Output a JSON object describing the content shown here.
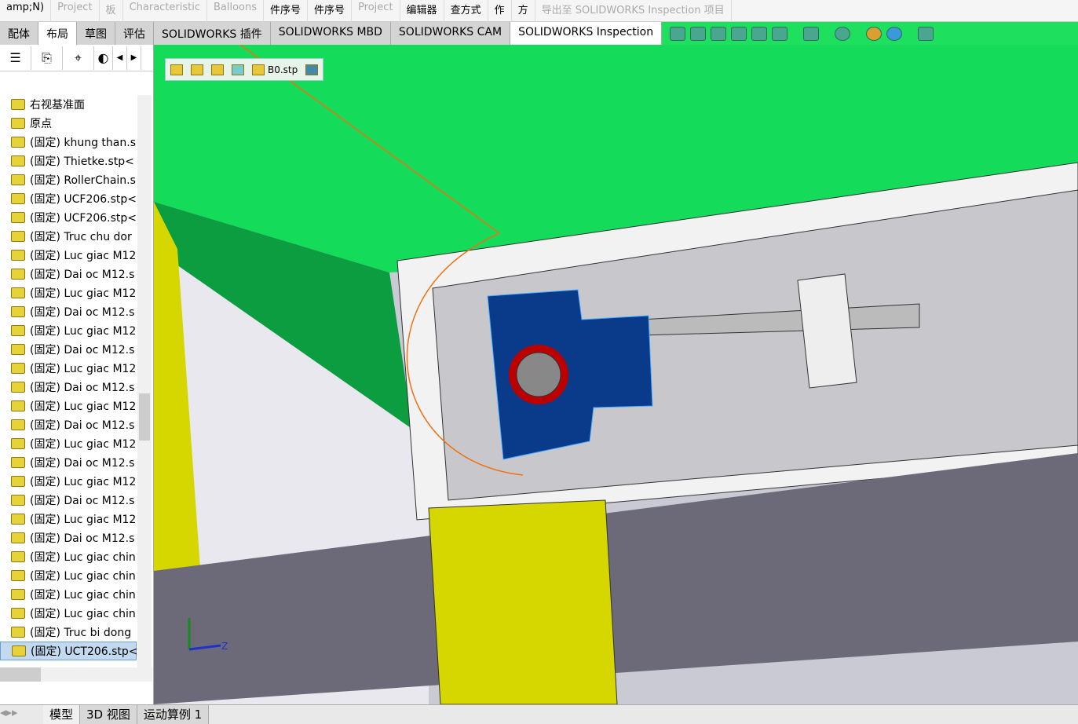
{
  "ribbon": [
    "amp;N)",
    "Project",
    "板",
    "Characteristic",
    "Balloons",
    "件序号",
    "件序号",
    "Project",
    "编辑器",
    "查方式",
    "作",
    "方",
    "导出至 SOLIDWORKS Inspection 项目"
  ],
  "tabs": [
    {
      "label": "配体"
    },
    {
      "label": "布局",
      "active": true
    },
    {
      "label": "草图"
    },
    {
      "label": "评估"
    },
    {
      "label": "SOLIDWORKS 插件"
    },
    {
      "label": "SOLIDWORKS MBD"
    },
    {
      "label": "SOLIDWORKS CAM"
    },
    {
      "label": "SOLIDWORKS Inspection",
      "active": true
    }
  ],
  "breadcrumb": {
    "file": "B0.stp"
  },
  "tree": {
    "items": [
      "右视基准面",
      "原点",
      "(固定) khung than.s",
      "(固定) Thietke.stp<",
      "(固定) RollerChain.s",
      "(固定) UCF206.stp<",
      "(固定) UCF206.stp<",
      "(固定) Truc chu dor",
      "(固定) Luc giac M12",
      "(固定) Dai oc M12.s",
      "(固定) Luc giac M12",
      "(固定) Dai oc M12.s",
      "(固定) Luc giac M12",
      "(固定) Dai oc M12.s",
      "(固定) Luc giac M12",
      "(固定) Dai oc M12.s",
      "(固定) Luc giac M12",
      "(固定) Dai oc M12.s",
      "(固定) Luc giac M12",
      "(固定) Dai oc M12.s",
      "(固定) Luc giac M12",
      "(固定) Dai oc M12.s",
      "(固定) Luc giac M12",
      "(固定) Dai oc M12.s",
      "(固定) Luc giac chin",
      "(固定) Luc giac chin",
      "(固定) Luc giac chin",
      "(固定) Luc giac chin",
      "(固定) Truc bi dong",
      "(固定) UCT206.stp<"
    ],
    "selected": 29
  },
  "triad": {
    "z": "Z"
  },
  "bottom_tabs": [
    "模型",
    "3D 视图",
    "运动算例 1"
  ],
  "colors": {
    "ribbon_green": "#1fdf5f",
    "conveyor": "#0fcf50",
    "bearing": "#0a3a8a",
    "post": "#d6d600"
  }
}
